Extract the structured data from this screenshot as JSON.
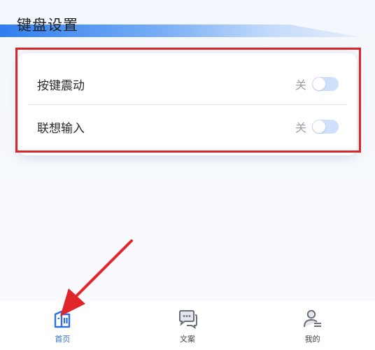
{
  "page": {
    "title": "键盘设置"
  },
  "settings": [
    {
      "label": "按键震动",
      "state": "关"
    },
    {
      "label": "联想输入",
      "state": "关"
    }
  ],
  "nav": [
    {
      "label": "首页",
      "icon": "home-icon",
      "active": true
    },
    {
      "label": "文案",
      "icon": "chat-icon",
      "active": false
    },
    {
      "label": "我的",
      "icon": "profile-icon",
      "active": false
    }
  ],
  "colors": {
    "accent": "#2f6fe0",
    "highlight": "#d9262b",
    "toggle_off": "#cfe0fb"
  }
}
